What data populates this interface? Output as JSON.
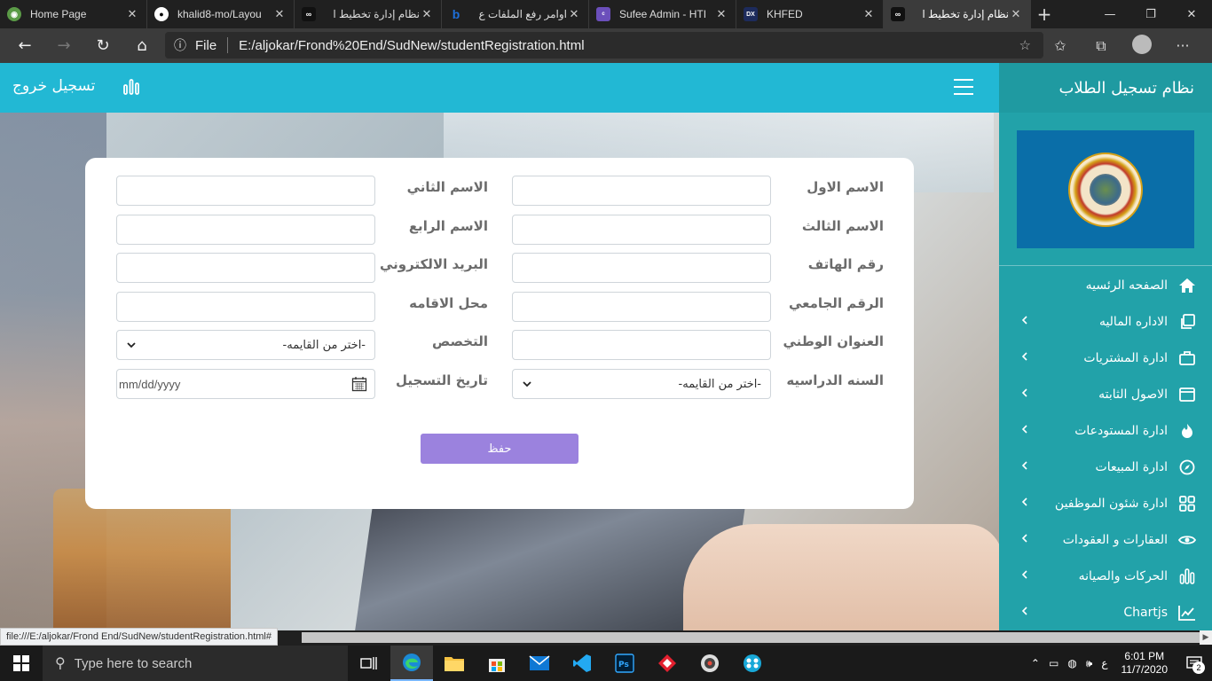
{
  "browser": {
    "tabs": [
      {
        "title": "Home Page",
        "icon": "globe-icon",
        "color": "#5b9b47"
      },
      {
        "title": "khalid8-mo/Layou",
        "icon": "github-icon",
        "color": "#ffffff"
      },
      {
        "title": "نظام إدارة تخطيط ا",
        "icon": "infinity-icon",
        "color": "#222222"
      },
      {
        "title": "اوامر رفع الملفات ع",
        "icon": "bing-icon",
        "color": "#1e6fd9"
      },
      {
        "title": "Sufee Admin - HTI",
        "icon": "colorlib-icon",
        "color": "#6b4fbb"
      },
      {
        "title": "KHFED",
        "icon": "dx-icon",
        "color": "#1d2b5c"
      },
      {
        "title": "نظام إدارة تخطيط ا",
        "icon": "infinity-icon",
        "color": "#222222",
        "active": true
      }
    ],
    "address": {
      "scheme_label": "File",
      "url": "E:/aljokar/Frond%20End/SudNew/studentRegistration.html"
    },
    "status_text": "file:///E:/aljokar/Frond End/SudNew/studentRegistration.html#"
  },
  "app": {
    "title": "نظام تسجيل الطلاب",
    "logout": "تسجيل خروج",
    "accent": "#22b8d4",
    "sidebar_color": "#22a2a9",
    "menu": [
      {
        "label": "الصفحه الرئسيه",
        "icon": "home-icon",
        "has_sub": false
      },
      {
        "label": "الاداره الماليه",
        "icon": "copy-icon",
        "has_sub": true
      },
      {
        "label": "ادارة المشتريات",
        "icon": "briefcase-icon",
        "has_sub": true
      },
      {
        "label": "الاصول الثابته",
        "icon": "window-icon",
        "has_sub": true
      },
      {
        "label": "ادارة المستودعات",
        "icon": "fire-icon",
        "has_sub": true
      },
      {
        "label": "ادارة المبيعات",
        "icon": "compass-icon",
        "has_sub": true
      },
      {
        "label": "ادارة شئون الموظفين",
        "icon": "grid-icon",
        "has_sub": true
      },
      {
        "label": "العقارات و العقودات",
        "icon": "eye-icon",
        "has_sub": true
      },
      {
        "label": "الحركات والصيانه",
        "icon": "bars-icon",
        "has_sub": true
      },
      {
        "label": "Chartjs",
        "icon": "line-chart-icon",
        "has_sub": true
      }
    ]
  },
  "form": {
    "first_name": "الاسم الاول",
    "second_name": "الاسم الثاني",
    "third_name": "الاسم الثالث",
    "fourth_name": "الاسم الرابع",
    "phone": "رقم الهاتف",
    "email": "البريد الالكتروني",
    "university_id": "الرقم الجامعي",
    "residence": "محل الاقامه",
    "national_address": "العنوان الوطني",
    "major": "التخصص",
    "major_value": "-اختر من القايمه-",
    "study_year": "السنه الدراسيه",
    "study_year_value": "-اختر من القايمه-",
    "reg_date": "تاريخ التسجيل",
    "reg_date_placeholder": "mm/dd/yyyy",
    "save": "حفظ",
    "save_color": "#9b82de"
  },
  "taskbar": {
    "search_placeholder": "Type here to search",
    "lang": "ع",
    "time": "6:01 PM",
    "date": "11/7/2020",
    "notifications": "2"
  }
}
